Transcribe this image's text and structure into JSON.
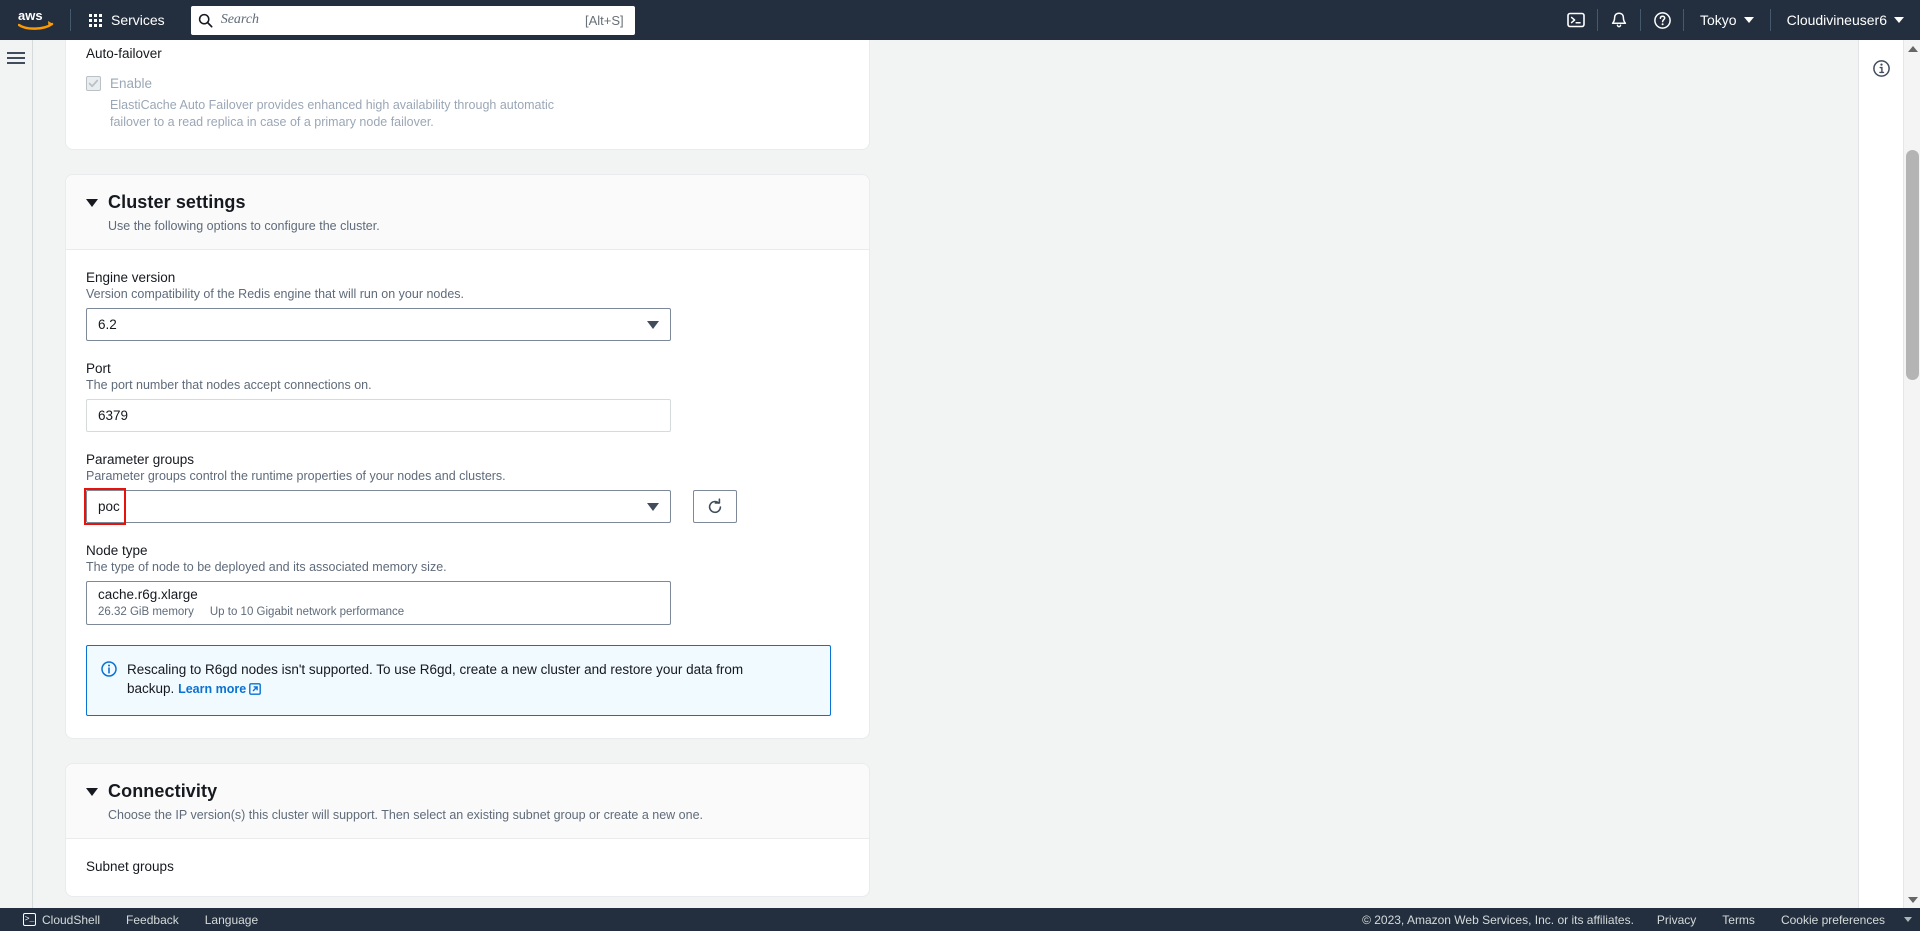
{
  "topnav": {
    "logo_alt": "aws",
    "services_label": "Services",
    "search_placeholder": "Search",
    "search_shortcut": "[Alt+S]",
    "cloudshell_icon": "cloudshell-icon",
    "notifications_icon": "bell-icon",
    "help_icon": "question-circle-icon",
    "region_label": "Tokyo",
    "account_label": "Cloudivineuser6"
  },
  "autofailover": {
    "label": "Auto-failover",
    "enable_label": "Enable",
    "enable_checked": true,
    "description": "ElastiCache Auto Failover provides enhanced high availability through automatic failover to a read replica in case of a primary node failover."
  },
  "cluster_settings": {
    "title": "Cluster settings",
    "subtitle": "Use the following options to configure the cluster.",
    "engine_version": {
      "label": "Engine version",
      "description": "Version compatibility of the Redis engine that will run on your nodes.",
      "value": "6.2"
    },
    "port": {
      "label": "Port",
      "description": "The port number that nodes accept connections on.",
      "value": "6379"
    },
    "parameter_groups": {
      "label": "Parameter groups",
      "description": "Parameter groups control the runtime properties of your nodes and clusters.",
      "value": "poc",
      "refresh_icon": "refresh-icon",
      "highlight_color": "#e8120c"
    },
    "node_type": {
      "label": "Node type",
      "description": "The type of node to be deployed and its associated memory size.",
      "value": "cache.r6g.xlarge",
      "memory": "26.32 GiB memory",
      "network": "Up to 10 Gigabit network performance"
    },
    "alert": {
      "icon": "info-circle-icon",
      "text": "Rescaling to R6gd nodes isn't supported. To use R6gd, create a new cluster and restore your data from backup.",
      "link_label": "Learn more",
      "accent_color": "#0972d3",
      "background_color": "#f1faff"
    }
  },
  "connectivity": {
    "title": "Connectivity",
    "subtitle": "Choose the IP version(s) this cluster will support. Then select an existing subnet group or create a new one.",
    "subnet_groups_label": "Subnet groups"
  },
  "right_panel": {
    "info_icon": "info-circle-icon"
  },
  "footer": {
    "cloudshell_label": "CloudShell",
    "feedback_label": "Feedback",
    "language_label": "Language",
    "copyright": "© 2023, Amazon Web Services, Inc. or its affiliates.",
    "privacy_label": "Privacy",
    "terms_label": "Terms",
    "cookie_label": "Cookie preferences"
  }
}
